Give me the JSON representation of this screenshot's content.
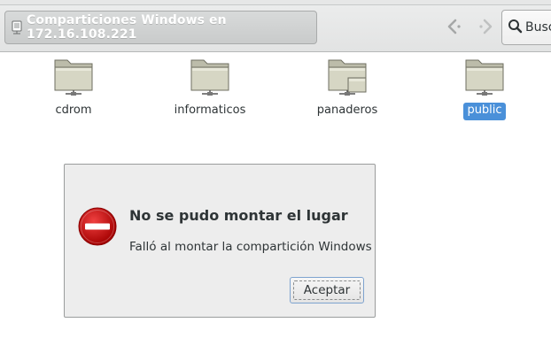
{
  "toolbar": {
    "path_label": "Comparticiones Windows en 172.16.108.221",
    "path_icon": "network-share-icon",
    "back_icon": "chevron-left-icon",
    "forward_icon": "chevron-right-icon",
    "search_label": "Busc",
    "search_icon": "magnifier-icon"
  },
  "folders": [
    {
      "label": "cdrom",
      "icon": "folder-remote-icon",
      "selected": false
    },
    {
      "label": "informaticos",
      "icon": "folder-remote-icon",
      "selected": false
    },
    {
      "label": "panaderos",
      "icon": "folder-remote-icon",
      "selected": false
    },
    {
      "label": "public",
      "icon": "folder-remote-icon",
      "selected": true
    }
  ],
  "dialog": {
    "icon": "error-icon",
    "title": "No se pudo montar el lugar",
    "message": "Falló al montar la compartición Windows",
    "accept_label": "Aceptar"
  },
  "colors": {
    "selection": "#4a90d9",
    "error_red": "#cc0000",
    "folder_body": "#d6d6c4"
  }
}
